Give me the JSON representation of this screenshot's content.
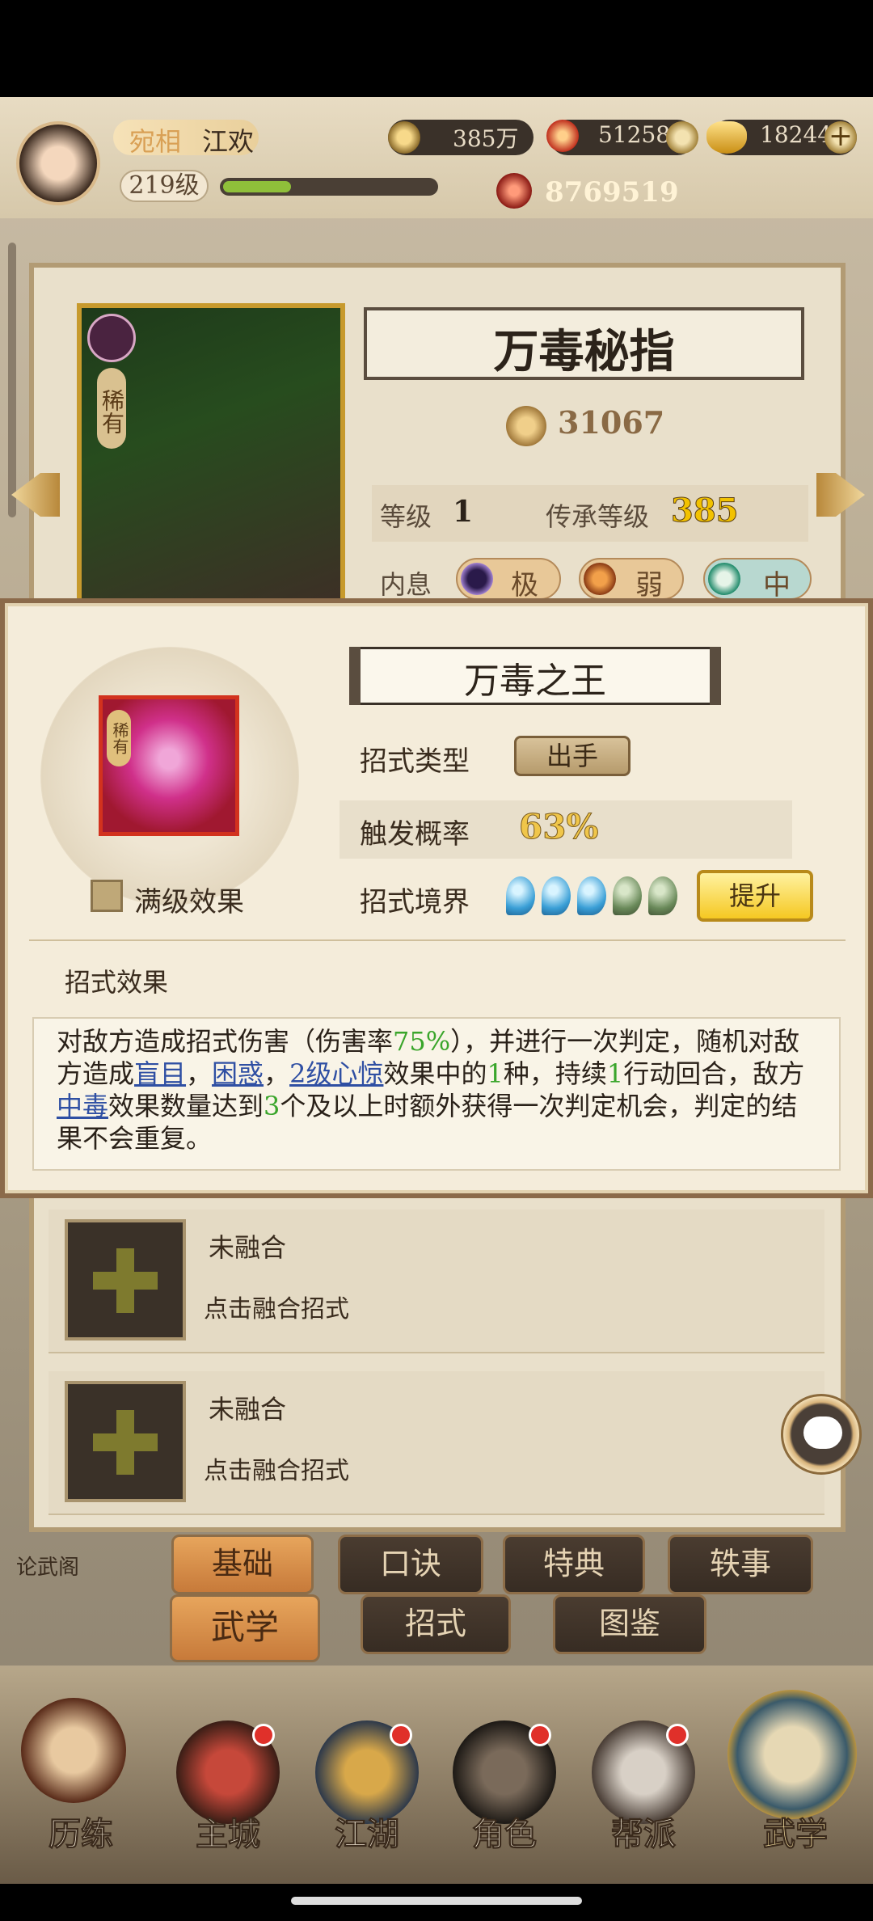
{
  "player": {
    "rank": "宛相",
    "name": "江欢",
    "level": "219级",
    "power": "8769519"
  },
  "currencies": [
    {
      "name": "copper",
      "value": "385万"
    },
    {
      "name": "spirit",
      "value": "51258"
    },
    {
      "name": "gold",
      "value": "18244"
    }
  ],
  "skill": {
    "title": "万毒秘指",
    "rarity": "稀有",
    "score": "31067",
    "level_label": "等级",
    "level_value": "1",
    "heir_label": "传承等级",
    "heir_value": "385",
    "neixi_label": "内息",
    "neixi": [
      "极",
      "弱",
      "中"
    ]
  },
  "popup": {
    "move_title": "万毒之王",
    "move_rarity": "稀有",
    "max_effect_label": "满级效果",
    "type_label": "招式类型",
    "type_value": "出手",
    "rate_label": "触发概率",
    "rate_value": "63%",
    "realm_label": "招式境界",
    "realm_level": 3,
    "realm_max": 5,
    "upgrade_label": "提升",
    "effect_section": "招式效果",
    "desc": {
      "p1": "对敌方造成招式伤害（伤害率",
      "rate": "75%",
      "p2": "），并进行一次判定，随机对敌方造成",
      "k1": "盲目",
      "s1": "，",
      "k2": "困惑",
      "s2": "，",
      "k3": "2级心惊",
      "p3": "效果中的",
      "n1": "1",
      "p4": "种，持续",
      "n2": "1",
      "p5": "行动回合，敌方",
      "k4": "中毒",
      "p6": "效果数量达到",
      "n3": "3",
      "p7": "个及以上时额外获得一次判定机会，判定的结果不会重复。"
    }
  },
  "fusion": [
    {
      "title": "未融合",
      "sub": "点击融合招式"
    },
    {
      "title": "未融合",
      "sub": "点击融合招式"
    }
  ],
  "side_label": "论武阁",
  "tabs_row1": [
    "基础",
    "口诀",
    "特典",
    "轶事"
  ],
  "tabs_row2": [
    "武学",
    "招式",
    "图鉴"
  ],
  "nav": [
    "历练",
    "主城",
    "江湖",
    "角色",
    "帮派",
    "武学"
  ],
  "colors": {
    "accent_gold": "#f2c200",
    "effect_green": "#3aa52b",
    "keyword_blue": "#2f4fa3"
  }
}
